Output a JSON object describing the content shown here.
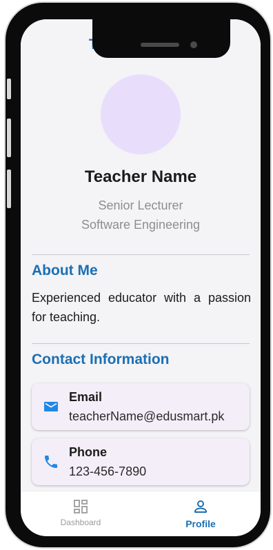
{
  "appbar": {
    "title": "Teacher Profile"
  },
  "profile": {
    "name": "Teacher Name",
    "designation": "Senior Lecturer",
    "department": "Software Engineering"
  },
  "about": {
    "heading": "About Me",
    "text": "Experienced educator with a passion for teaching."
  },
  "contact": {
    "heading": "Contact Information",
    "items": [
      {
        "label": "Email",
        "value": "teacherName@edusmart.pk",
        "icon": "mail-icon"
      },
      {
        "label": "Phone",
        "value": "123-456-7890",
        "icon": "phone-icon"
      }
    ]
  },
  "bottom_nav": {
    "items": [
      {
        "label": "Dashboard",
        "icon": "dashboard-icon",
        "active": false
      },
      {
        "label": "Profile",
        "icon": "person-icon",
        "active": true
      }
    ]
  },
  "colors": {
    "accent": "#1a6fb3",
    "avatar": "#e8defc",
    "card": "#f3eef8",
    "contact_icon": "#1e88e5"
  }
}
